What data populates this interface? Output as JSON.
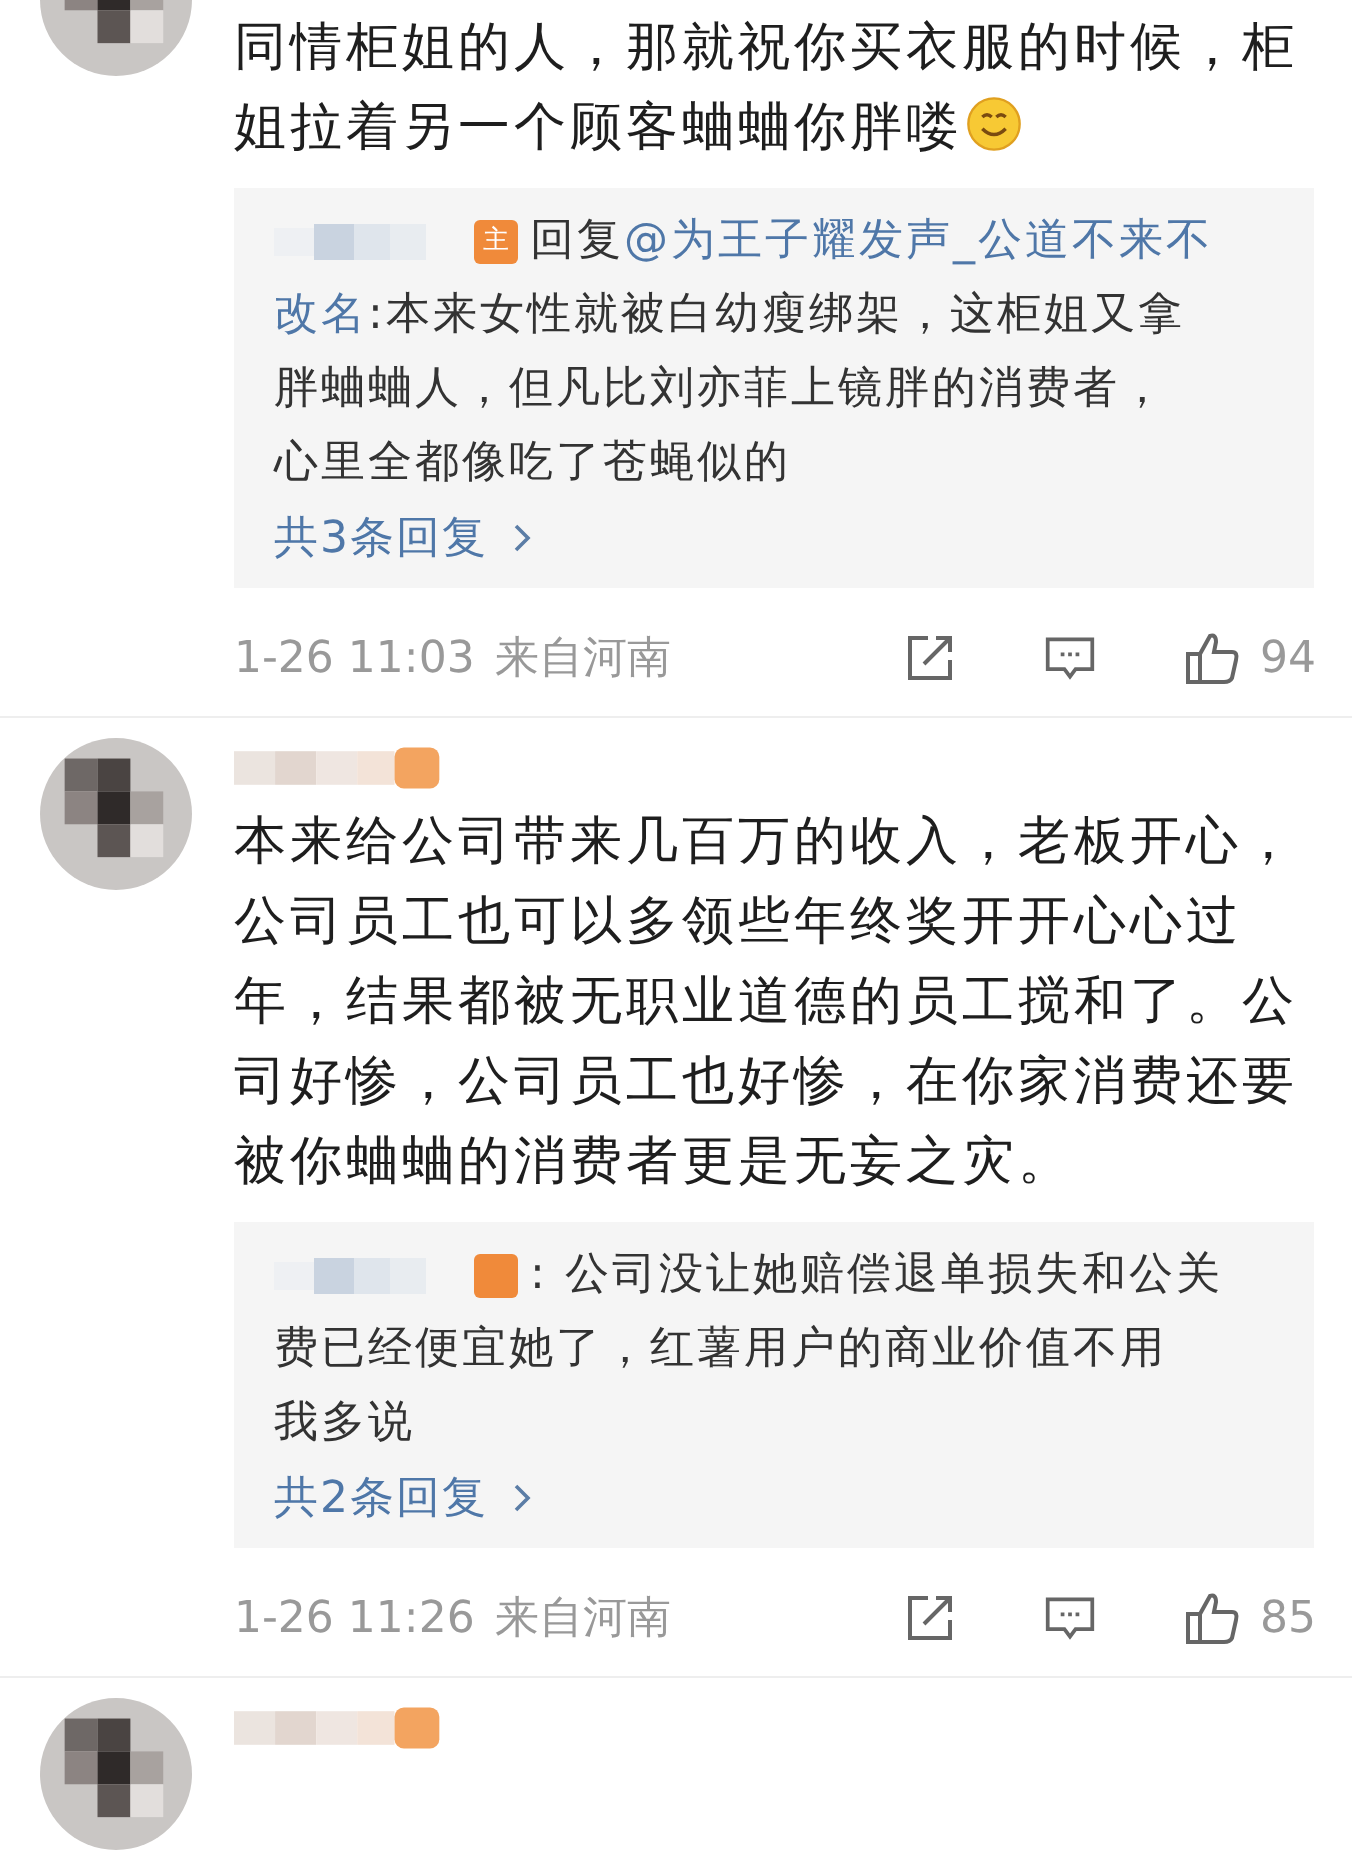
{
  "comments": [
    {
      "blurred_name": false,
      "emoji": true,
      "lines": [
        "同情柜姐的人，那就祝你买衣服的时候，柜",
        "姐拉着另一个顾客蛐蛐你胖喽"
      ],
      "reply": {
        "badge": "主",
        "lines": [
          [
            {
              "text": "回复",
              "link": false
            },
            {
              "text": "@为王子耀发声_公道不来不",
              "link": true
            }
          ],
          [
            {
              "text": "改名",
              "link": true
            },
            {
              "text": ":本来女性就被白幼瘦绑架，这柜姐又拿",
              "link": false
            }
          ],
          [
            {
              "text": "胖蛐蛐人，但凡比刘亦菲上镜胖的消费者，",
              "link": false
            }
          ],
          [
            {
              "text": "心里全都像吃了苍蝇似的",
              "link": false
            }
          ]
        ],
        "more": "共3条回复"
      },
      "time": "1-26 11:03",
      "location": "来自河南",
      "likes": "94"
    },
    {
      "blurred_name": true,
      "emoji": false,
      "lines": [
        "本来给公司带来几百万的收入，老板开心，",
        "公司员工也可以多领些年终奖开开心心过",
        "年，结果都被无职业道德的员工搅和了。公",
        "司好惨，公司员工也好惨，在你家消费还要",
        "被你蛐蛐的消费者更是无妄之灾。"
      ],
      "reply": {
        "lines": [
          [
            {
              "text": ": 公司没让她赔偿退单损失和公关",
              "link": false
            }
          ],
          [
            {
              "text": "费已经便宜她了，红薯用户的商业价值不用",
              "link": false
            }
          ],
          [
            {
              "text": "我多说",
              "link": false
            }
          ]
        ],
        "more": "共2条回复"
      },
      "time": "1-26 11:26",
      "location": "来自河南",
      "likes": "85"
    },
    {
      "blurred_name": true,
      "emoji": false
    }
  ]
}
